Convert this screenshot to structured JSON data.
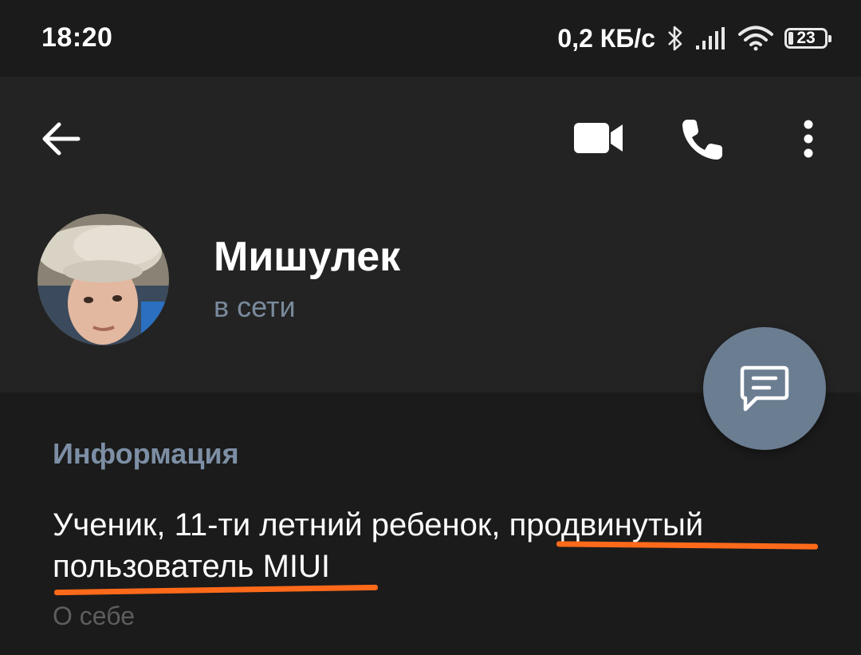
{
  "status_bar": {
    "time": "18:20",
    "network_speed": "0,2 КБ/с",
    "battery_level": "23",
    "icons": [
      "bluetooth-icon",
      "signal-icon",
      "wifi-icon",
      "battery-icon"
    ]
  },
  "toolbar": {
    "icons": [
      "back-arrow-icon",
      "video-camera-icon",
      "phone-icon",
      "more-vertical-icon"
    ]
  },
  "profile": {
    "name": "Мишулек",
    "status": "в сети"
  },
  "fab": {
    "icon": "message-icon",
    "color": "#6b7d91"
  },
  "info": {
    "heading": "Информация",
    "bio_part1": "Ученик, 11-ти летний ребенок, ",
    "bio_part2": "продвинутый пользователь MIUI",
    "bio_caption": "О себе"
  },
  "colors": {
    "background": "#1b1b1b",
    "header": "#232323",
    "accent_text": "#7d8fa5",
    "highlight_underline": "#ff6a1a"
  }
}
